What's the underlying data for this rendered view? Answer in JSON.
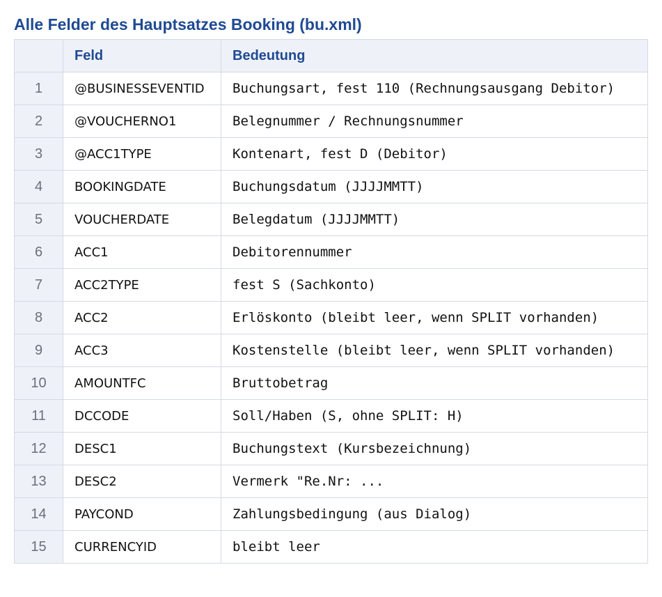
{
  "page_title": "Alle Felder des Hauptsatzes Booking (bu.xml)",
  "table": {
    "headers": {
      "number": "",
      "field": "Feld",
      "meaning": "Bedeutung"
    },
    "rows": [
      {
        "number": "1",
        "field": "@BUSINESSEVENTID",
        "meaning": "Buchungsart, fest 110 (Rechnungsausgang Debitor)"
      },
      {
        "number": "2",
        "field": "@VOUCHERNO1",
        "meaning": "Belegnummer / Rechnungsnummer"
      },
      {
        "number": "3",
        "field": "@ACC1TYPE",
        "meaning": "Kontenart, fest D (Debitor)"
      },
      {
        "number": "4",
        "field": "BOOKINGDATE",
        "meaning": "Buchungsdatum (JJJJMMTT)"
      },
      {
        "number": "5",
        "field": "VOUCHERDATE",
        "meaning": "Belegdatum (JJJJMMTT)"
      },
      {
        "number": "6",
        "field": "ACC1",
        "meaning": "Debitorennummer"
      },
      {
        "number": "7",
        "field": "ACC2TYPE",
        "meaning": "fest S (Sachkonto)"
      },
      {
        "number": "8",
        "field": "ACC2",
        "meaning": "Erlöskonto (bleibt leer, wenn SPLIT vorhanden)"
      },
      {
        "number": "9",
        "field": "ACC3",
        "meaning": "Kostenstelle (bleibt leer, wenn SPLIT vorhanden)"
      },
      {
        "number": "10",
        "field": "AMOUNTFC",
        "meaning": "Bruttobetrag"
      },
      {
        "number": "11",
        "field": "DCCODE",
        "meaning": "Soll/Haben (S, ohne SPLIT: H)"
      },
      {
        "number": "12",
        "field": "DESC1",
        "meaning": "Buchungstext (Kursbezeichnung)"
      },
      {
        "number": "13",
        "field": "DESC2",
        "meaning": "Vermerk \"Re.Nr: ..."
      },
      {
        "number": "14",
        "field": "PAYCOND",
        "meaning": "Zahlungsbedingung (aus Dialog)"
      },
      {
        "number": "15",
        "field": "CURRENCYID",
        "meaning": "bleibt leer"
      }
    ]
  },
  "colors": {
    "title": "#1f4a93",
    "header_background": "#eef2f8",
    "border": "#d4d9e3",
    "row_number_text": "#6a6f78"
  }
}
